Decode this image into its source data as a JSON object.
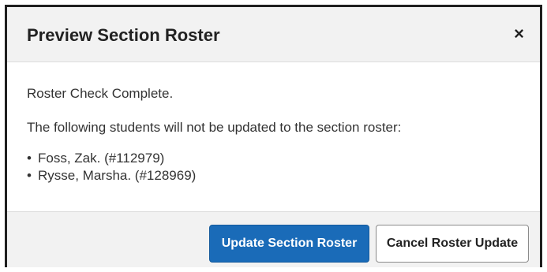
{
  "dialog": {
    "title": "Preview Section Roster",
    "close_glyph": "×",
    "close_icon": "close-icon"
  },
  "body": {
    "message_1": "Roster Check Complete.",
    "message_2": "The following students will not be updated to the section roster:",
    "students": [
      "Foss, Zak. (#112979)",
      "Rysse, Marsha. (#128969)"
    ]
  },
  "footer": {
    "primary_label": "Update Section Roster",
    "secondary_label": "Cancel Roster Update"
  },
  "colors": {
    "primary": "#1a6bb8",
    "header_bg": "#f2f2f2"
  }
}
